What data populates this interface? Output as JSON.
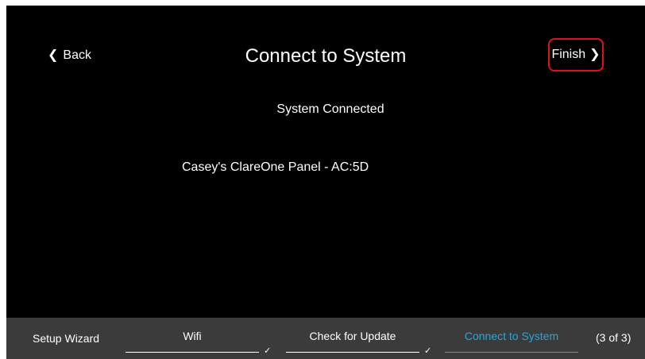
{
  "header": {
    "back_label": "Back",
    "title": "Connect to System",
    "finish_label": "Finish",
    "highlight_color": "#e0101b"
  },
  "main": {
    "status": "System Connected",
    "system_name": "Casey's ClareOne Panel  - AC:5D"
  },
  "footer": {
    "wizard_label": "Setup Wizard",
    "steps": [
      {
        "label": "Wifi",
        "completed": true,
        "active": false
      },
      {
        "label": "Check for Update",
        "completed": true,
        "active": false
      },
      {
        "label": "Connect to System",
        "completed": false,
        "active": true
      }
    ],
    "progress": "(3 of 3)",
    "active_color": "#2aa5d8"
  },
  "icons": {
    "back": "chevron-left-icon",
    "finish": "chevron-right-icon",
    "step_done": "checkmark-icon"
  }
}
